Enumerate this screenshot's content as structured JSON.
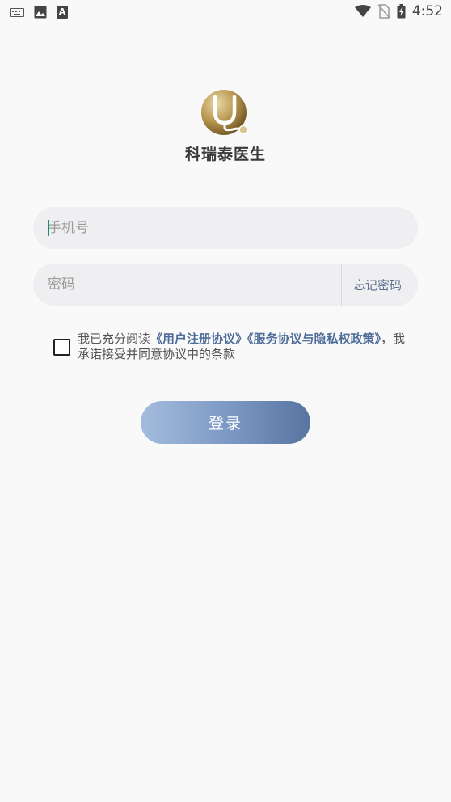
{
  "status_bar": {
    "time": "4:52",
    "left_icons": [
      "keyboard-icon",
      "image-icon",
      "a-icon"
    ],
    "right_icons": [
      "wifi-icon",
      "no-sim-icon",
      "battery-icon"
    ],
    "a_icon_text": "A"
  },
  "logo": {
    "app_name": "科瑞泰医生",
    "colors": {
      "gold_light": "#d9c48f",
      "gold_dark": "#7a5e2a"
    }
  },
  "form": {
    "phone_placeholder": "手机号",
    "password_placeholder": "密码",
    "forgot_label": "忘记密码"
  },
  "agreement": {
    "prefix": "我已充分阅读",
    "user_agreement_link": "《用户注册协议》",
    "privacy_link": "《服务协议与隐私权政策》",
    "suffix": "，我承诺接受并同意协议中的条款",
    "checked": false
  },
  "login": {
    "label": "登录",
    "colors": {
      "from": "#a3bbdd",
      "to": "#5874a1"
    }
  },
  "theme": {
    "background": "#f9f9f9",
    "field_bg": "#efeff1",
    "link_color": "#4f6d9a",
    "caret_color": "#1e8a6e"
  }
}
